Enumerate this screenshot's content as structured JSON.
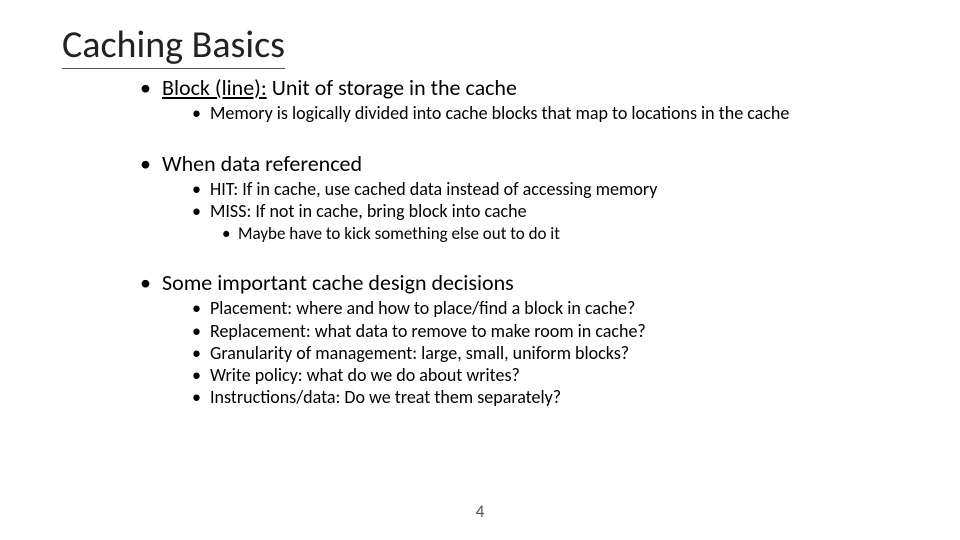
{
  "title": "Caching Basics",
  "bullets": {
    "b1": {
      "label_u": "Block (line):",
      "label_rest": " Unit of storage in the cache",
      "sub": [
        "Memory is logically divided into cache blocks that map to locations in the cache"
      ]
    },
    "b2": {
      "label": "When data referenced",
      "sub": [
        "HIT: If in cache, use cached data instead of accessing memory",
        "MISS: If not in cache, bring block into cache"
      ],
      "subsub": [
        "Maybe have to kick something else out to do it"
      ]
    },
    "b3": {
      "label": "Some important cache design decisions",
      "sub": [
        "Placement: where and how to place/find a block in cache?",
        "Replacement: what data to remove to make room in cache?",
        "Granularity of management: large, small, uniform blocks?",
        "Write policy: what do we do about writes?",
        "Instructions/data: Do we treat them separately?"
      ]
    }
  },
  "page_number": "4"
}
